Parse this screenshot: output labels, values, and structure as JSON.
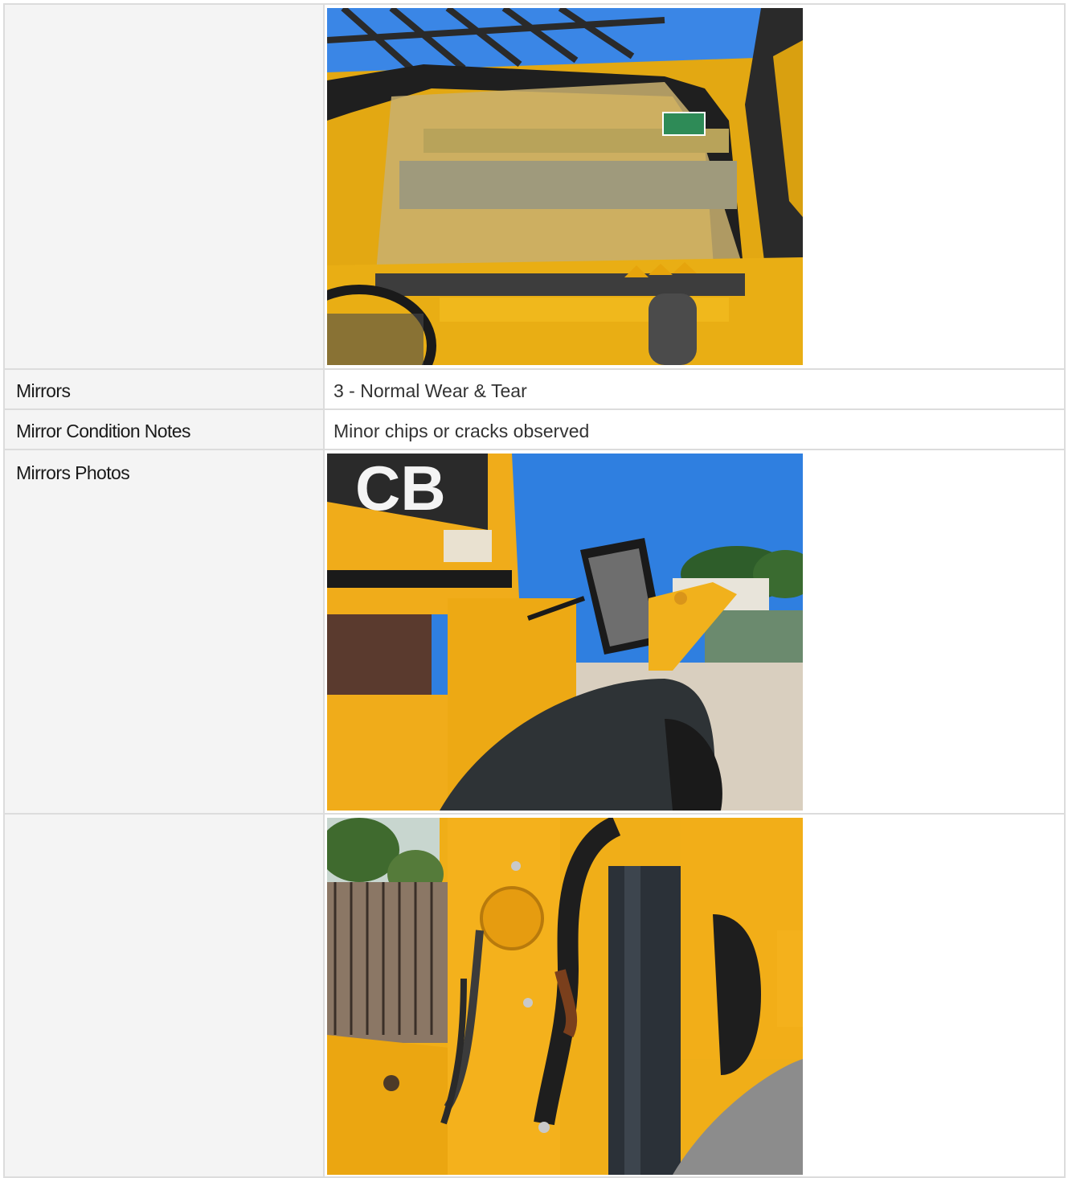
{
  "rows": [
    {
      "label": "",
      "type": "photo",
      "photo": "cab-windshield-photo"
    },
    {
      "label": "Mirrors",
      "type": "text",
      "value": "3 - Normal Wear & Tear"
    },
    {
      "label": "Mirror Condition Notes",
      "type": "text",
      "value": "Minor chips or cracks observed"
    },
    {
      "label": "Mirrors Photos",
      "type": "photo",
      "photo": "side-mirror-photo"
    },
    {
      "label": "",
      "type": "photo",
      "photo": "hydraulic-hose-photo"
    }
  ],
  "colors": {
    "label_bg": "#f4f4f4",
    "border": "#dcdcdc",
    "machine_yellow": "#f2b21a",
    "sky_blue": "#2f7fe0"
  }
}
